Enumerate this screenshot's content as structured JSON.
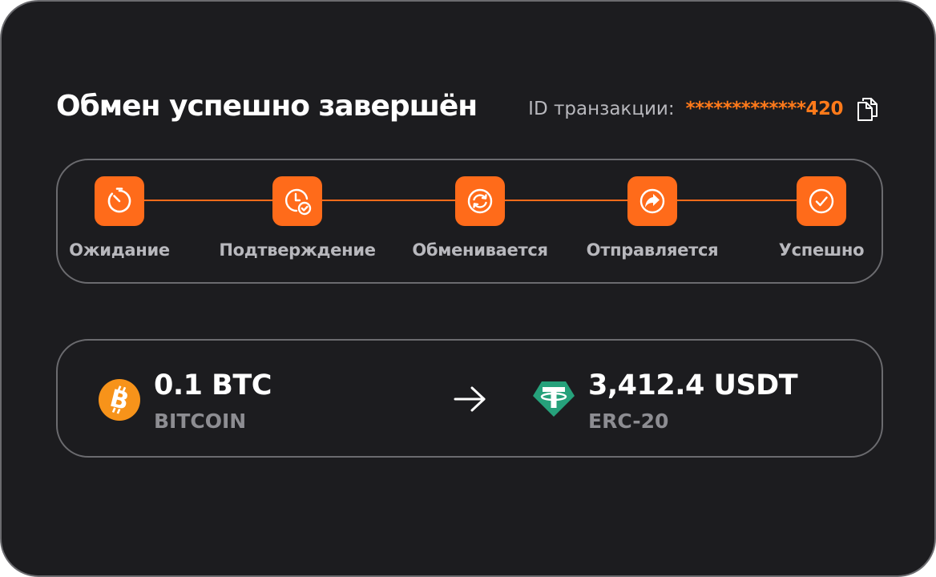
{
  "header": {
    "title": "Обмен успешно завершён",
    "tx_label": "ID транзакции:",
    "tx_value": "*************420",
    "copy_icon": "copy-icon"
  },
  "steps": [
    {
      "label": "Ожидание",
      "icon": "timer-icon"
    },
    {
      "label": "Подтверждение",
      "icon": "clock-check-icon"
    },
    {
      "label": "Обменивается",
      "icon": "refresh-icon"
    },
    {
      "label": "Отправляется",
      "icon": "forward-arrow-icon"
    },
    {
      "label": "Успешно",
      "icon": "check-circle-icon"
    }
  ],
  "exchange": {
    "from": {
      "amount": "0.1 BTC",
      "name": "BITCOIN",
      "icon": "bitcoin-icon"
    },
    "to": {
      "amount": "3,412.4 USDT",
      "name": "ERC-20",
      "icon": "tether-icon"
    },
    "arrow_icon": "arrow-right-icon"
  },
  "colors": {
    "background": "#1c1c1f",
    "accent": "#ff6b1a",
    "tx_value": "#ff7a1a",
    "border": "#6b6b6f",
    "muted_text": "#b8b8bd",
    "bitcoin": "#f7931a",
    "tether": "#26a17b"
  }
}
